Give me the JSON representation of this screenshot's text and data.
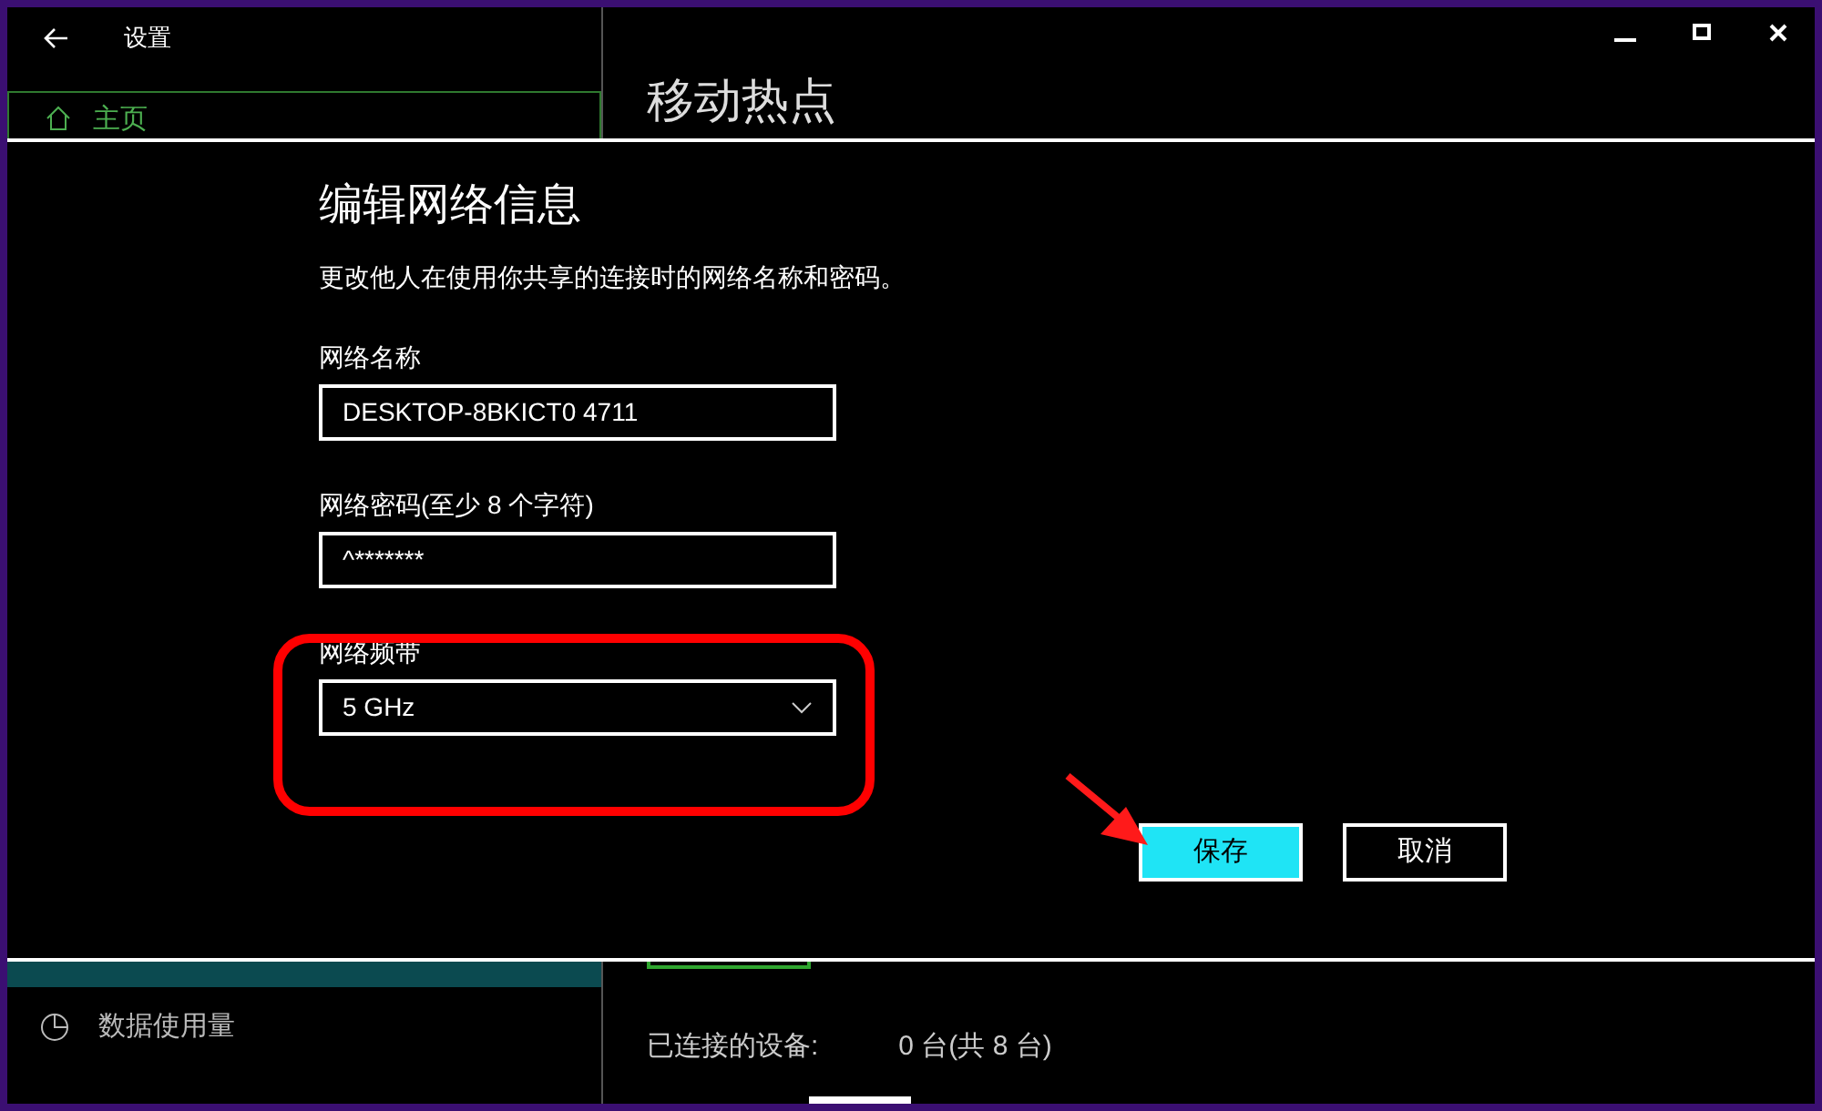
{
  "window": {
    "title": "设置"
  },
  "sidebar": {
    "home": {
      "label": "主页",
      "selected": true
    },
    "items": [
      {
        "selected": true
      },
      {
        "label": "数据使用量",
        "selected": false
      }
    ]
  },
  "page": {
    "title": "移动热点",
    "connected_label": "已连接的设备:",
    "connected_value": "0 台(共 8 台)"
  },
  "dialog": {
    "title": "编辑网络信息",
    "description": "更改他人在使用你共享的连接时的网络名称和密码。",
    "fields": [
      {
        "kind": "text",
        "label": "网络名称",
        "value": "DESKTOP-8BKICT0 4711"
      },
      {
        "kind": "text",
        "label": "网络密码(至少 8 个字符)",
        "value": "^*******"
      },
      {
        "kind": "dropdown",
        "label": "网络频带",
        "value": "5 GHz"
      }
    ],
    "buttons": [
      {
        "label": "保存",
        "primary": true
      },
      {
        "label": "取消",
        "primary": false
      }
    ]
  }
}
